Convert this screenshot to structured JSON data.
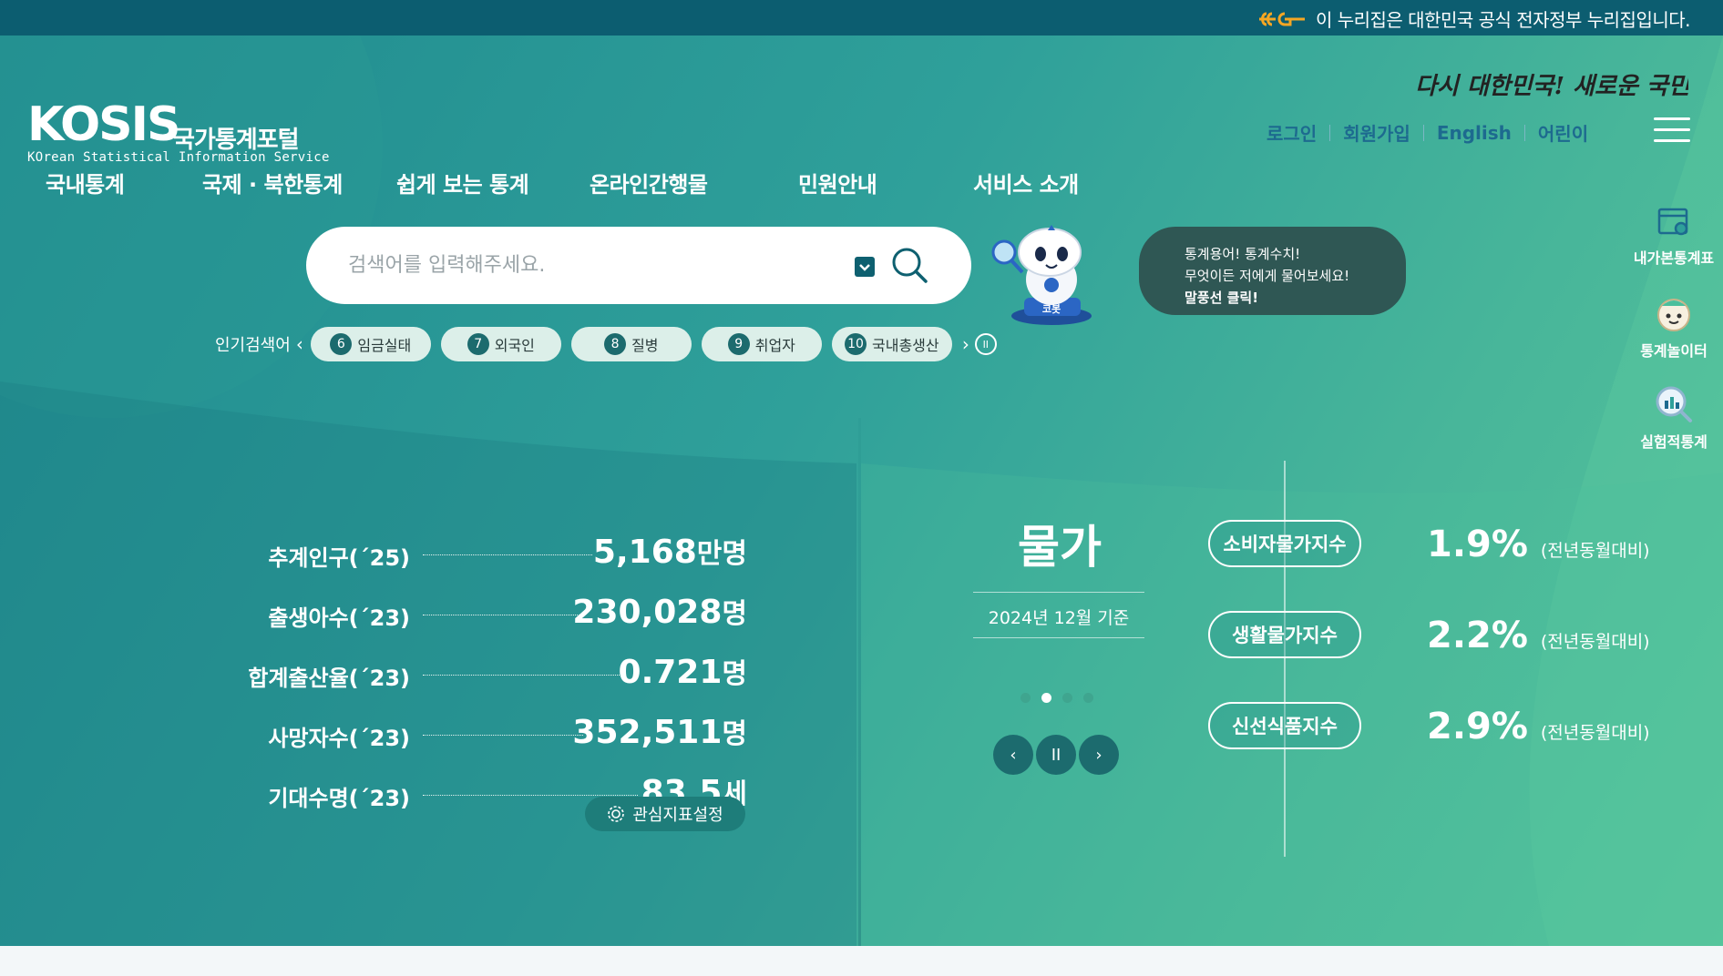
{
  "gov_banner": {
    "text": "이 누리집은 대한민국 공식 전자정부 누리집입니다."
  },
  "header": {
    "slogan": "다시 대한민국! 새로운 국민의 나라",
    "logo": {
      "main": "KOSIS",
      "korean": "국가통계포털",
      "sub": "KOrean Statistical Information Service"
    },
    "util_links": [
      "로그인",
      "회원가입",
      "English",
      "어린이"
    ]
  },
  "gnb": [
    "국내통계",
    "국제 · 북한통계",
    "쉽게 보는 통계",
    "온라인간행물",
    "민원안내",
    "서비스 소개"
  ],
  "search": {
    "placeholder": "검색어를 입력해주세요.",
    "popular_label": "인기검색어",
    "popular": [
      {
        "rank": "6",
        "term": "임금실태"
      },
      {
        "rank": "7",
        "term": "외국인"
      },
      {
        "rank": "8",
        "term": "질병"
      },
      {
        "rank": "9",
        "term": "취업자"
      },
      {
        "rank": "10",
        "term": "국내총생산"
      }
    ]
  },
  "chatbot": {
    "name": "코봇",
    "bubble": [
      "통계용어! 통계수치!",
      "무엇이든 저에게 물어보세요!",
      "말풍선 클릭!"
    ]
  },
  "quick_menu": [
    "내가본통계표",
    "통계놀이터",
    "실험적통계"
  ],
  "indicators": [
    {
      "label": "추계인구(´25)",
      "value": "5,168",
      "unit": "만명"
    },
    {
      "label": "출생아수(´23)",
      "value": "230,028",
      "unit": "명"
    },
    {
      "label": "합계출산율(´23)",
      "value": "0.721",
      "unit": "명"
    },
    {
      "label": "사망자수(´23)",
      "value": "352,511",
      "unit": "명"
    },
    {
      "label": "기대수명(´23)",
      "value": "83.5",
      "unit": "세"
    }
  ],
  "interest_button": "관심지표설정",
  "price": {
    "title": "물가",
    "date": "2024년 12월 기준",
    "items": [
      {
        "name": "소비자물가지수",
        "value": "1.9%",
        "note": "(전년동월대비)"
      },
      {
        "name": "생활물가지수",
        "value": "2.2%",
        "note": "(전년동월대비)"
      },
      {
        "name": "신선식품지수",
        "value": "2.9%",
        "note": "(전년동월대비)"
      }
    ],
    "active_slide": 2,
    "total_slides": 4
  }
}
